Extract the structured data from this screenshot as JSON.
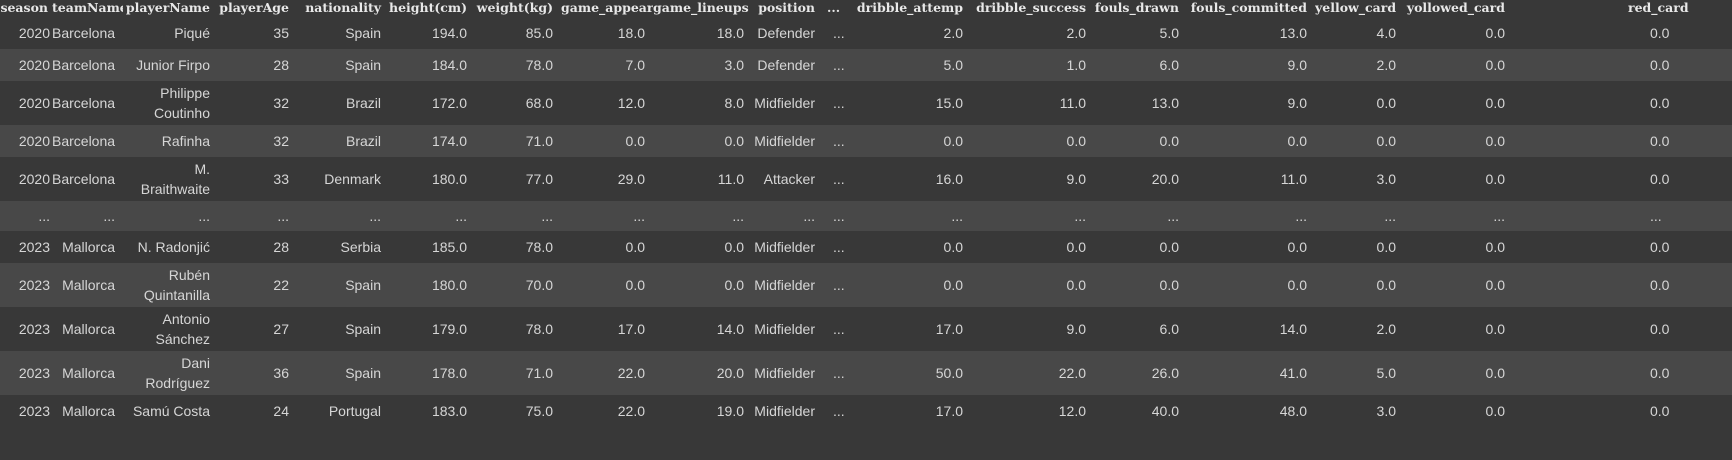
{
  "table": {
    "columns": [
      "season",
      "teamName",
      "playerName",
      "playerAge",
      "nationality",
      "height(cm)",
      "weight(kg)",
      "game_appear",
      "game_lineups",
      "position",
      "...",
      "dribble_attemp",
      "dribble_success",
      "fouls_drawn",
      "fouls_committed",
      "yellow_card",
      "yollowed_card",
      "red_card"
    ],
    "rows": [
      [
        "2020",
        "Barcelona",
        "Piqué",
        "35",
        "Spain",
        "194.0",
        "85.0",
        "18.0",
        "18.0",
        "Defender",
        "...",
        "2.0",
        "2.0",
        "5.0",
        "13.0",
        "4.0",
        "0.0",
        "0.0"
      ],
      [
        "2020",
        "Barcelona",
        "Junior Firpo",
        "28",
        "Spain",
        "184.0",
        "78.0",
        "7.0",
        "3.0",
        "Defender",
        "...",
        "5.0",
        "1.0",
        "6.0",
        "9.0",
        "2.0",
        "0.0",
        "0.0"
      ],
      [
        "2020",
        "Barcelona",
        "Philippe Coutinho",
        "32",
        "Brazil",
        "172.0",
        "68.0",
        "12.0",
        "8.0",
        "Midfielder",
        "...",
        "15.0",
        "11.0",
        "13.0",
        "9.0",
        "0.0",
        "0.0",
        "0.0"
      ],
      [
        "2020",
        "Barcelona",
        "Rafinha",
        "32",
        "Brazil",
        "174.0",
        "71.0",
        "0.0",
        "0.0",
        "Midfielder",
        "...",
        "0.0",
        "0.0",
        "0.0",
        "0.0",
        "0.0",
        "0.0",
        "0.0"
      ],
      [
        "2020",
        "Barcelona",
        "M. Braithwaite",
        "33",
        "Denmark",
        "180.0",
        "77.0",
        "29.0",
        "11.0",
        "Attacker",
        "...",
        "16.0",
        "9.0",
        "20.0",
        "11.0",
        "3.0",
        "0.0",
        "0.0"
      ],
      [
        "...",
        "...",
        "...",
        "...",
        "...",
        "...",
        "...",
        "...",
        "...",
        "...",
        "...",
        "...",
        "...",
        "...",
        "...",
        "...",
        "...",
        "..."
      ],
      [
        "2023",
        "Mallorca",
        "N. Radonjić",
        "28",
        "Serbia",
        "185.0",
        "78.0",
        "0.0",
        "0.0",
        "Midfielder",
        "...",
        "0.0",
        "0.0",
        "0.0",
        "0.0",
        "0.0",
        "0.0",
        "0.0"
      ],
      [
        "2023",
        "Mallorca",
        "Rubén Quintanilla",
        "22",
        "Spain",
        "180.0",
        "70.0",
        "0.0",
        "0.0",
        "Midfielder",
        "...",
        "0.0",
        "0.0",
        "0.0",
        "0.0",
        "0.0",
        "0.0",
        "0.0"
      ],
      [
        "2023",
        "Mallorca",
        "Antonio Sánchez",
        "27",
        "Spain",
        "179.0",
        "78.0",
        "17.0",
        "14.0",
        "Midfielder",
        "...",
        "17.0",
        "9.0",
        "6.0",
        "14.0",
        "2.0",
        "0.0",
        "0.0"
      ],
      [
        "2023",
        "Mallorca",
        "Dani Rodríguez",
        "36",
        "Spain",
        "178.0",
        "71.0",
        "22.0",
        "20.0",
        "Midfielder",
        "...",
        "50.0",
        "22.0",
        "26.0",
        "41.0",
        "5.0",
        "0.0",
        "0.0"
      ],
      [
        "2023",
        "Mallorca",
        "Samú Costa",
        "24",
        "Portugal",
        "183.0",
        "75.0",
        "22.0",
        "19.0",
        "Midfielder",
        "...",
        "17.0",
        "12.0",
        "40.0",
        "48.0",
        "3.0",
        "0.0",
        "0.0"
      ]
    ]
  },
  "colors": {
    "background": "#383838",
    "row_alt": "#484848",
    "text": "#d6d6d6",
    "header_text": "#e8e8e8"
  }
}
